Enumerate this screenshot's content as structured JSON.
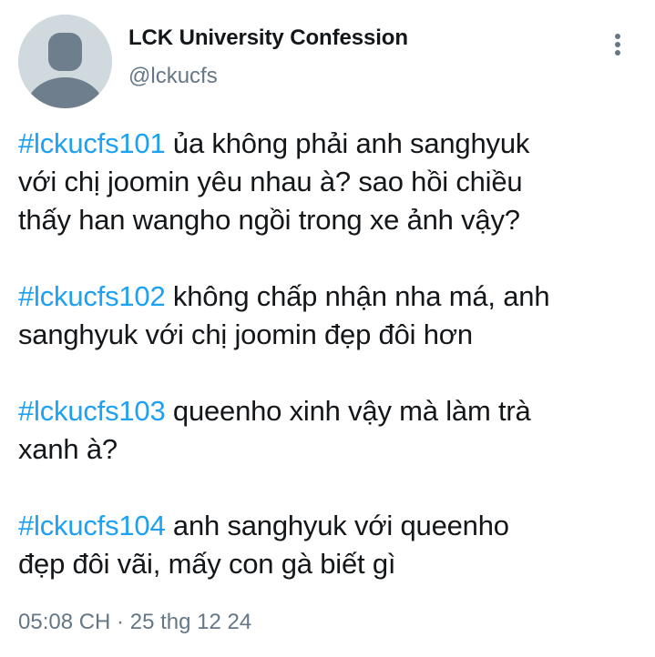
{
  "author": {
    "display_name": "LCK University Confession",
    "handle": "@lckucfs",
    "avatar_icon": "default-avatar-icon"
  },
  "more_icon": "vertical-ellipsis-icon",
  "tweet": {
    "paragraphs": [
      {
        "hashtag": "#lckucfs101",
        "text": " ủa không phải anh sanghyuk\nvới chị joomin yêu nhau à? sao hồi chiều\nthấy han wangho ngồi trong xe ảnh vậy?"
      },
      {
        "hashtag": "#lckucfs102",
        "text": " không chấp nhận nha má, anh\nsanghyuk với chị joomin đẹp đôi hơn"
      },
      {
        "hashtag": "#lckucfs103",
        "text": " queenho xinh vậy mà làm trà\nxanh à?"
      },
      {
        "hashtag": "#lckucfs104",
        "text": " anh sanghyuk với queenho\nđẹp đôi vãi, mấy con gà biết gì"
      }
    ]
  },
  "meta": {
    "time": "05:08 CH",
    "separator": " · ",
    "date": "25 thg 12 24"
  },
  "colors": {
    "hashtag": "#1da1f2",
    "text": "#14171a",
    "secondary": "#657786",
    "avatar_bg": "#cfd9de",
    "avatar_fg": "#6e7e8c"
  }
}
